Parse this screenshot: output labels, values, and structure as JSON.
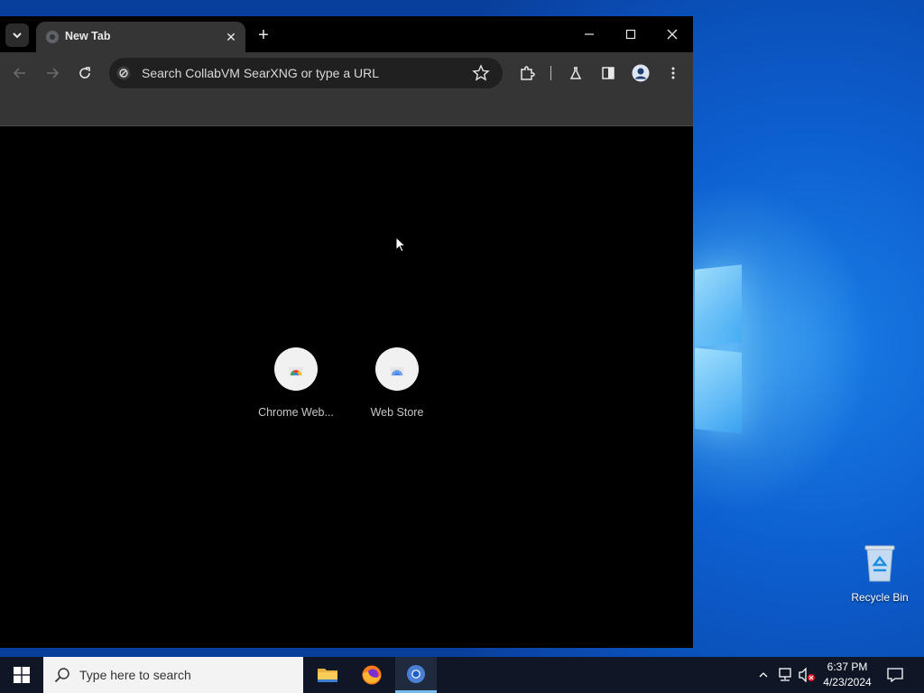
{
  "browser": {
    "tab": {
      "title": "New Tab",
      "close_glyph": "✕"
    },
    "new_tab_glyph": "+",
    "omnibox": {
      "placeholder": "Search CollabVM SearXNG or type a URL"
    },
    "shortcuts": [
      {
        "label": "Chrome Web...",
        "icon": "chrome-web-store-icon"
      },
      {
        "label": "Web Store",
        "icon": "web-store-icon"
      }
    ]
  },
  "desktop": {
    "recycle_bin_label": "Recycle Bin"
  },
  "taskbar": {
    "search_placeholder": "Type here to search",
    "apps": [
      "file-explorer-icon",
      "firefox-icon",
      "chrome-icon"
    ],
    "clock": {
      "time": "6:37 PM",
      "date": "4/23/2024"
    }
  },
  "colors": {
    "accent": "#76b9ed",
    "desktop_blue": "#0d5fcf",
    "browser_chrome": "#353535"
  }
}
